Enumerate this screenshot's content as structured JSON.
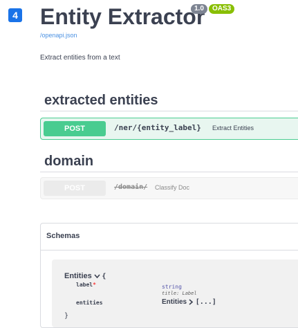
{
  "header": {
    "step_number": "4",
    "title": "Entity Extractor",
    "version": "1.0",
    "oas": "OAS3",
    "spec_link": "/openapi.json",
    "description": "Extract entities from a text"
  },
  "tags": [
    {
      "name": "extracted entities",
      "operations": [
        {
          "method": "POST",
          "path": "/ner/{entity_label}",
          "summary": "Extract Entities",
          "deprecated": false
        }
      ]
    },
    {
      "name": "domain",
      "operations": [
        {
          "method": "POST",
          "path": "/domain/",
          "summary": "Classify Doc",
          "deprecated": true
        }
      ]
    }
  ],
  "schemas": {
    "title": "Schemas",
    "model": {
      "name": "Entities",
      "expand_icon": "chevron-down-icon",
      "open_brace": "{",
      "close_brace": "}",
      "properties": [
        {
          "name": "label",
          "required_mark": "*",
          "type": "string",
          "title": "title: Label"
        },
        {
          "name": "entities",
          "ref_name": "Entities",
          "ref_icon": "chevron-right-icon",
          "ref_tail": "[...]"
        }
      ]
    }
  },
  "colors": {
    "post": "#49cc90",
    "post_bg": "#e8f6f0",
    "deprecated": "#ebebeb",
    "badge_version": "#7d8492",
    "badge_oas": "#89bf04",
    "step_badge": "#1a73e8"
  }
}
